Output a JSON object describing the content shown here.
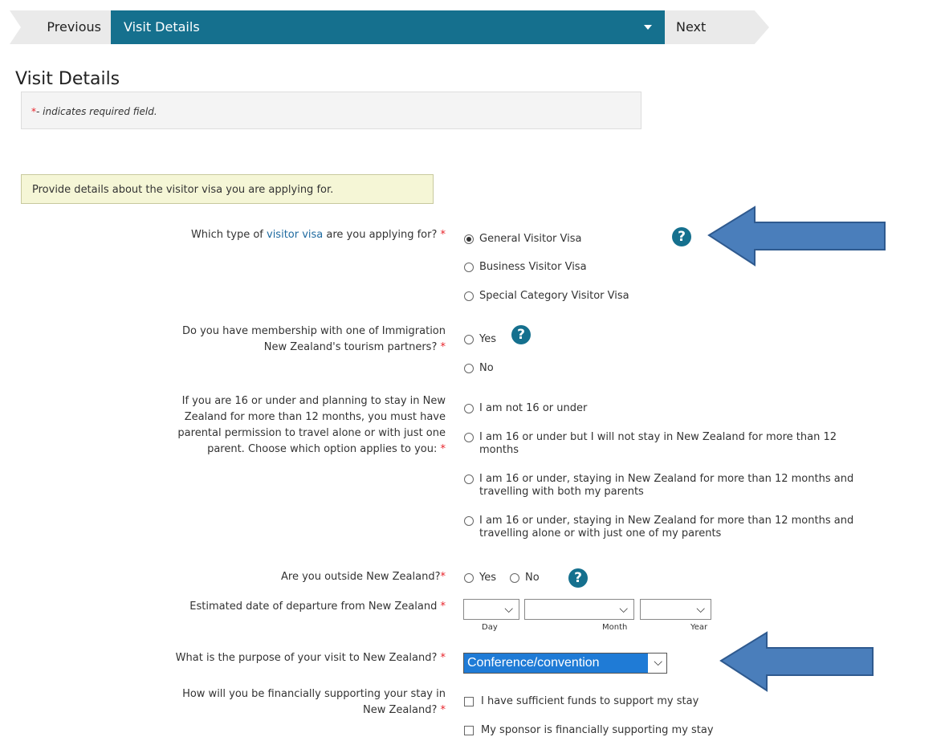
{
  "nav": {
    "previous": "Previous",
    "current": "Visit Details",
    "next": "Next"
  },
  "page_title": "Visit Details",
  "required_note": {
    "star": "*",
    "text": "- indicates required field."
  },
  "intro": "Provide details about the visitor visa you are applying for.",
  "q_visa_type": {
    "prefix": "Which type of ",
    "link": "visitor visa",
    "suffix": " are you applying for?",
    "options": [
      "General Visitor Visa",
      "Business Visitor Visa",
      "Special Category Visitor Visa"
    ],
    "selected": "General Visitor Visa"
  },
  "q_membership": {
    "line1": "Do you have membership with one of Immigration",
    "line2": "New Zealand's tourism partners?",
    "options": [
      "Yes",
      "No"
    ]
  },
  "q_age": {
    "line1": "If you are 16 or under and planning to stay in New",
    "line2": "Zealand for more than 12 months, you must have",
    "line3": "parental permission to travel alone or with just one",
    "line4": "parent. Choose which option applies to you:",
    "options": [
      {
        "l1": "I am not 16 or under",
        "l2": ""
      },
      {
        "l1": "I am 16 or under but I will not stay in New Zealand for more than 12",
        "l2": "months"
      },
      {
        "l1": "I am 16 or under, staying in New Zealand for more than 12 months and",
        "l2": "travelling with both my parents"
      },
      {
        "l1": "I am 16 or under, staying in New Zealand for more than 12 months and",
        "l2": "travelling alone or with just one of my parents"
      }
    ]
  },
  "q_outside": {
    "label": "Are you outside New Zealand?",
    "options": [
      "Yes",
      "No"
    ]
  },
  "q_departure": {
    "label": "Estimated date of departure from New Zealand",
    "day": "Day",
    "month": "Month",
    "year": "Year"
  },
  "q_purpose": {
    "label": "What is the purpose of your visit to New Zealand?",
    "value": "Conference/convention"
  },
  "q_funds": {
    "line1": "How will you be financially supporting your stay in",
    "line2": "New Zealand?",
    "options": [
      "I have sufficient funds to support my stay",
      "My sponsor is financially supporting my stay"
    ]
  },
  "help_icon": "?",
  "required_star": "*",
  "colors": {
    "nav_active": "#15708e",
    "arrow": "#4a7ebb",
    "required": "#e8232a",
    "link": "#1e6aa0"
  }
}
